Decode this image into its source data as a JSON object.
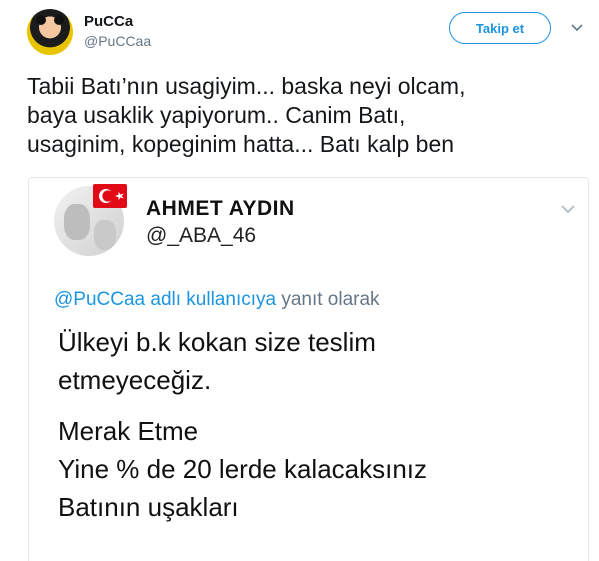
{
  "tweet": {
    "display_name": "PuCCa",
    "handle": "@PuCCaa",
    "follow_label": "Takip et",
    "text": "Tabii Batı’nın usagiyim... baska neyi olcam,\nbaya usaklik yapiyorum.. Canim Batı,\nusaginim, kopeginim hatta... Batı kalp ben"
  },
  "quoted": {
    "display_name": "AHMET AYDIN",
    "handle": "@_ABA_46",
    "reply_mention": "@PuCCaa adlı kullanıcıya",
    "reply_suffix": " yanıt olarak",
    "paragraph_1": "Ülkeyi b.k kokan size teslim\netmeyeceğiz.",
    "paragraph_2": "Merak Etme\nYine % de 20 lerde kalacaksınız\nBatının uşakları"
  },
  "icons": {
    "caret": "chevron-down-icon",
    "flag": "turkish-flag-icon"
  },
  "colors": {
    "accent": "#1b95e0",
    "secondary_text": "#657786",
    "border": "#e1e8ed",
    "flag_red": "#e30a17"
  }
}
